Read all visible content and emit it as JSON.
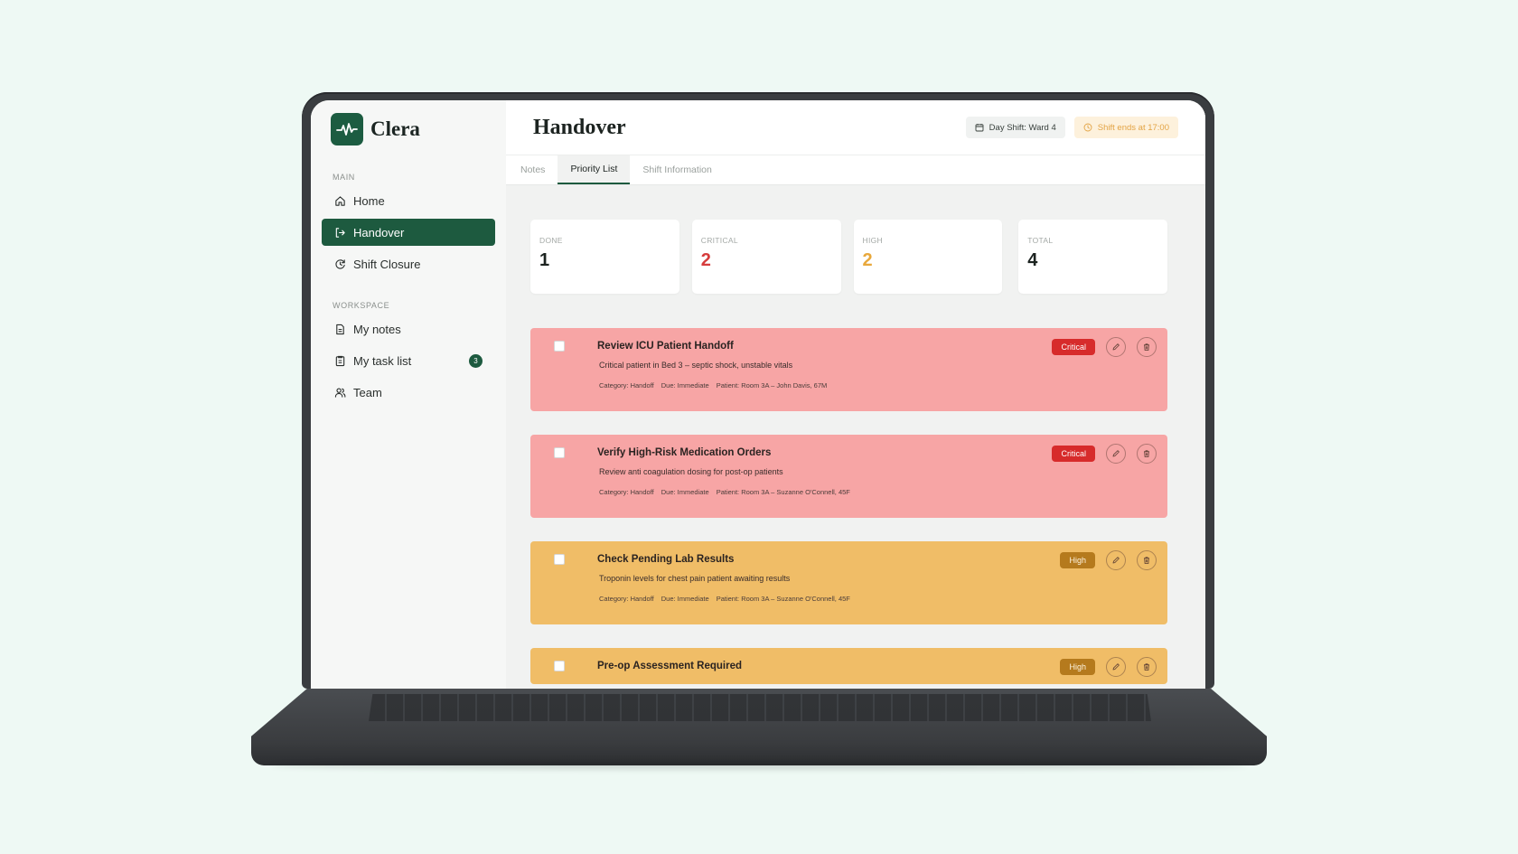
{
  "brand": {
    "name": "Clera"
  },
  "sidebar": {
    "main_label": "MAIN",
    "workspace_label": "WORKSPACE",
    "main_items": [
      {
        "label": "Home",
        "icon": "home-icon"
      },
      {
        "label": "Handover",
        "icon": "handover-icon"
      },
      {
        "label": "Shift Closure",
        "icon": "shift-closure-icon"
      }
    ],
    "workspace_items": [
      {
        "label": "My notes",
        "icon": "notes-icon"
      },
      {
        "label": "My task list",
        "icon": "task-list-icon",
        "badge": "3"
      },
      {
        "label": "Team",
        "icon": "team-icon"
      }
    ]
  },
  "header": {
    "title": "Handover",
    "shift_label": "Day Shift: Ward 4",
    "shift_end": "Shift ends at 17:00"
  },
  "tabs": [
    {
      "label": "Notes"
    },
    {
      "label": "Priority List"
    },
    {
      "label": "Shift Information"
    }
  ],
  "stats": [
    {
      "label": "DONE",
      "value": "1"
    },
    {
      "label": "CRITICAL",
      "value": "2"
    },
    {
      "label": "HIGH",
      "value": "2"
    },
    {
      "label": "TOTAL",
      "value": "4"
    }
  ],
  "tasks": [
    {
      "title": "Review ICU Patient Handoff",
      "description": "Critical patient in Bed 3 – septic shock, unstable vitals",
      "category": "Category: Handoff",
      "due": "Due: Immediate",
      "patient": "Patient: Room 3A – John Davis, 67M",
      "priority": "Critical"
    },
    {
      "title": "Verify High-Risk Medication Orders",
      "description": "Review anti coagulation dosing for post-op patients",
      "category": "Category: Handoff",
      "due": "Due: Immediate",
      "patient": "Patient: Room 3A – Suzanne O'Connell, 45F",
      "priority": "Critical"
    },
    {
      "title": "Check Pending Lab Results",
      "description": "Troponin levels for chest pain patient awaiting results",
      "category": "Category: Handoff",
      "due": "Due: Immediate",
      "patient": "Patient: Room 3A – Suzanne O'Connell, 45F",
      "priority": "High"
    },
    {
      "title": "Pre-op Assessment Required",
      "priority": "High"
    }
  ],
  "colors": {
    "brand_green": "#1d5a3f",
    "critical_bg": "#f7a5a5",
    "critical_badge": "#d72b2b",
    "high_bg": "#f0bd67",
    "high_badge": "#b57a1d"
  }
}
